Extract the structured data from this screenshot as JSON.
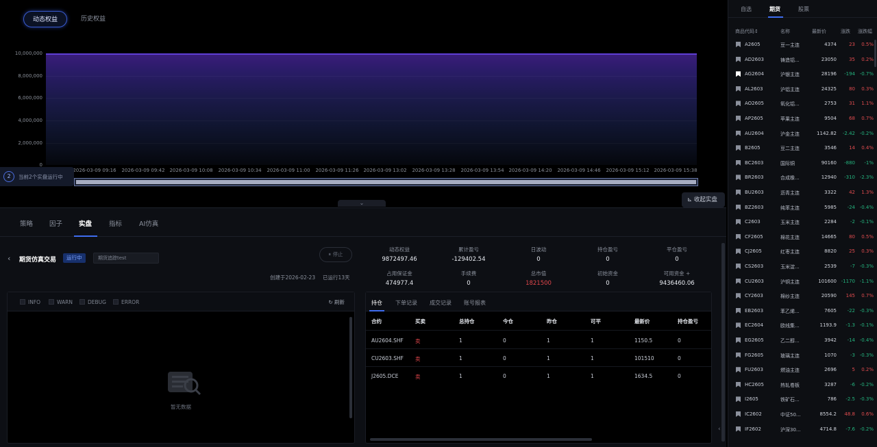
{
  "chart": {
    "tabs": [
      "动态权益",
      "历史权益"
    ],
    "y_ticks": [
      "10,000,000",
      "8,000,000",
      "6,000,000",
      "4,000,000",
      "2,000,000",
      "0"
    ],
    "x_ticks": [
      "2026-03-09 09:16",
      "2026-03-09 09:42",
      "2026-03-09 10:08",
      "2026-03-09 10:34",
      "2026-03-09 11:00",
      "2026-03-09 11:26",
      "2026-03-09 13:02",
      "2026-03-09 13:28",
      "2026-03-09 13:54",
      "2026-03-09 14:20",
      "2026-03-09 14:46",
      "2026-03-09 15:12",
      "2026-03-09 15:38"
    ],
    "running_count": "2",
    "running_text": "当前2个实盘运行中",
    "collapse_label": "收起实盘",
    "line_color": "#5f3fd6"
  },
  "tabs": [
    "策略",
    "因子",
    "实盘",
    "指标",
    "AI仿真"
  ],
  "strategy": {
    "name": "期货仿真交易",
    "status": "运行中",
    "select_value": "期货追踪test",
    "stop_label": "停止",
    "created": "创建于2026-02-23",
    "running": "已运行13天"
  },
  "stats": [
    {
      "label": "动态权益",
      "value": "9872497.46"
    },
    {
      "label": "累计盈亏",
      "value": "-129402.54"
    },
    {
      "label": "日波动",
      "value": "0"
    },
    {
      "label": "持仓盈亏",
      "value": "0"
    },
    {
      "label": "平仓盈亏",
      "value": "0"
    },
    {
      "label": "占用保证金",
      "value": "474977.4"
    },
    {
      "label": "手续费",
      "value": "0"
    },
    {
      "label": "总市值",
      "value": "1821500"
    },
    {
      "label": "初始资金",
      "value": "0"
    },
    {
      "label": "可用资金 +",
      "value": "9436460.06"
    }
  ],
  "log": {
    "levels": [
      "INFO",
      "WARN",
      "DEBUG",
      "ERROR"
    ],
    "refresh": "刷新",
    "empty": "暂无数据"
  },
  "positions": {
    "tabs": [
      "持仓",
      "下单记录",
      "成交记录",
      "账号报表"
    ],
    "headers": [
      "合约",
      "买卖",
      "总持仓",
      "今仓",
      "昨仓",
      "可平",
      "最新价",
      "持仓盈亏"
    ],
    "rows": [
      [
        "AU2604.SHF",
        "卖",
        "1",
        "0",
        "1",
        "1",
        "1150.5",
        "0"
      ],
      [
        "CU2603.SHF",
        "卖",
        "1",
        "0",
        "1",
        "1",
        "101510",
        "0"
      ],
      [
        "J2605.DCE",
        "卖",
        "1",
        "0",
        "1",
        "1",
        "1634.5",
        "0"
      ]
    ]
  },
  "sidebar": {
    "tabs": [
      "自选",
      "期货",
      "股票"
    ],
    "headers": [
      "商品代码↕",
      "名称",
      "最新价",
      "涨跌",
      "涨跌幅"
    ],
    "rows": [
      [
        "A2605",
        "豆一主连",
        "4374",
        "23",
        "0.5%",
        "up"
      ],
      [
        "AD2603",
        "铸造铝...",
        "23050",
        "35",
        "0.2%",
        "up"
      ],
      [
        "AG2604",
        "沪银主连",
        "28196",
        "-194",
        "-0.7%",
        "dn"
      ],
      [
        "AL2603",
        "沪铝主连",
        "24325",
        "80",
        "0.3%",
        "up"
      ],
      [
        "AO2605",
        "氧化铝...",
        "2753",
        "31",
        "1.1%",
        "up"
      ],
      [
        "AP2605",
        "苹果主连",
        "9504",
        "68",
        "0.7%",
        "up"
      ],
      [
        "AU2604",
        "沪金主连",
        "1142.82",
        "-2.42",
        "-0.2%",
        "dn"
      ],
      [
        "B2605",
        "豆二主连",
        "3546",
        "14",
        "0.4%",
        "up"
      ],
      [
        "BC2603",
        "国际铜",
        "90160",
        "-880",
        "-1%",
        "dn"
      ],
      [
        "BR2603",
        "合成橡...",
        "12940",
        "-310",
        "-2.3%",
        "dn"
      ],
      [
        "BU2603",
        "沥青主连",
        "3322",
        "42",
        "1.3%",
        "up"
      ],
      [
        "BZ2603",
        "纯苯主连",
        "5985",
        "-24",
        "-0.4%",
        "dn"
      ],
      [
        "C2603",
        "玉米主连",
        "2284",
        "-2",
        "-0.1%",
        "dn"
      ],
      [
        "CF2605",
        "棉花主连",
        "14665",
        "80",
        "0.5%",
        "up"
      ],
      [
        "CJ2605",
        "红枣主连",
        "8820",
        "25",
        "0.3%",
        "up"
      ],
      [
        "CS2603",
        "玉米淀...",
        "2539",
        "-7",
        "-0.3%",
        "dn"
      ],
      [
        "CU2603",
        "沪铜主连",
        "101600",
        "-1170",
        "-1.1%",
        "dn"
      ],
      [
        "CY2603",
        "棉纱主连",
        "20590",
        "145",
        "0.7%",
        "up"
      ],
      [
        "EB2603",
        "苯乙烯...",
        "7605",
        "-22",
        "-0.3%",
        "dn"
      ],
      [
        "EC2604",
        "欧线集...",
        "1193.9",
        "-1.3",
        "-0.1%",
        "dn"
      ],
      [
        "EG2605",
        "乙二醇...",
        "3942",
        "-14",
        "-0.4%",
        "dn"
      ],
      [
        "FG2605",
        "玻璃主连",
        "1070",
        "-3",
        "-0.3%",
        "dn"
      ],
      [
        "FU2603",
        "燃油主连",
        "2696",
        "5",
        "0.2%",
        "up"
      ],
      [
        "HC2605",
        "热轧卷板",
        "3287",
        "-6",
        "-0.2%",
        "dn"
      ],
      [
        "I2605",
        "铁矿石...",
        "786",
        "-2.5",
        "-0.3%",
        "dn"
      ],
      [
        "IC2602",
        "中证50...",
        "8554.2",
        "48.8",
        "0.6%",
        "up"
      ],
      [
        "IF2602",
        "沪深30...",
        "4714.8",
        "-7.6",
        "-0.2%",
        "dn"
      ]
    ]
  }
}
